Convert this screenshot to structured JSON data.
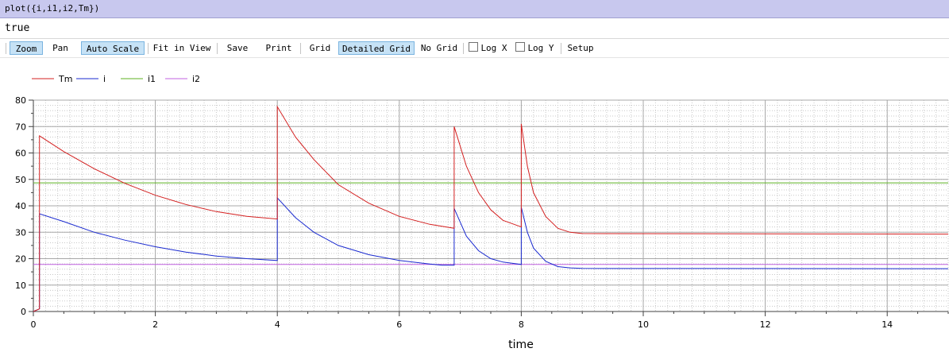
{
  "command": "plot({i,i1,i2,Tm})",
  "result": "true",
  "toolbar": {
    "zoom": "Zoom",
    "pan": "Pan",
    "auto_scale": "Auto Scale",
    "fit_in_view": "Fit in View",
    "save": "Save",
    "print": "Print",
    "grid": "Grid",
    "detailed_grid": "Detailed Grid",
    "no_grid": "No Grid",
    "log_x": "Log X",
    "log_y": "Log Y",
    "setup": "Setup"
  },
  "colors": {
    "Tm": "#d42020",
    "i": "#1a2ad0",
    "i1": "#5cb020",
    "i2": "#c060e0"
  },
  "chart_data": {
    "type": "line",
    "xlabel": "time",
    "ylabel": "",
    "xlim": [
      0,
      15
    ],
    "ylim": [
      0,
      80
    ],
    "xticks": [
      0,
      2,
      4,
      6,
      8,
      10,
      12,
      14
    ],
    "yticks": [
      0,
      10,
      20,
      30,
      40,
      50,
      60,
      70,
      80
    ],
    "grid": "detailed",
    "legend": "top-left",
    "series": [
      {
        "name": "Tm",
        "x": [
          0,
          0.1,
          0.1,
          0.5,
          1,
          1.5,
          2,
          2.5,
          3,
          3.5,
          4,
          4,
          4.3,
          4.6,
          5,
          5.5,
          6,
          6.5,
          6.9,
          6.9,
          7.1,
          7.3,
          7.5,
          7.7,
          8,
          8,
          8.1,
          8.2,
          8.4,
          8.6,
          8.8,
          9,
          15
        ],
        "values": [
          0,
          1,
          66.5,
          60.5,
          54,
          48.5,
          44,
          40.5,
          37.8,
          36,
          35,
          77.5,
          66,
          57.5,
          48,
          41,
          36,
          33,
          31.5,
          70,
          55,
          45,
          38.5,
          34.5,
          32,
          71,
          55,
          45,
          36,
          31.5,
          30,
          29.5,
          29.3
        ]
      },
      {
        "name": "i",
        "x": [
          0,
          0.1,
          0.1,
          0.5,
          1,
          1.5,
          2,
          2.5,
          3,
          3.5,
          4,
          4,
          4.3,
          4.6,
          5,
          5.5,
          6,
          6.5,
          6.7,
          6.9,
          6.9,
          7.1,
          7.3,
          7.5,
          7.7,
          8,
          8,
          8.1,
          8.2,
          8.4,
          8.6,
          8.8,
          9,
          15
        ],
        "values": [
          0,
          1,
          37,
          34,
          30,
          27,
          24.5,
          22.5,
          21,
          20,
          19.3,
          43,
          35.5,
          30,
          25,
          21.5,
          19.3,
          18,
          17.5,
          17.5,
          39,
          28.5,
          23,
          20,
          18.7,
          17.8,
          39.5,
          30,
          24,
          19,
          17,
          16.5,
          16.3,
          16.2
        ]
      },
      {
        "name": "i1",
        "x": [
          0,
          15
        ],
        "values": [
          48.7,
          48.7
        ]
      },
      {
        "name": "i2",
        "x": [
          0,
          15
        ],
        "values": [
          17.8,
          17.8
        ]
      }
    ]
  }
}
